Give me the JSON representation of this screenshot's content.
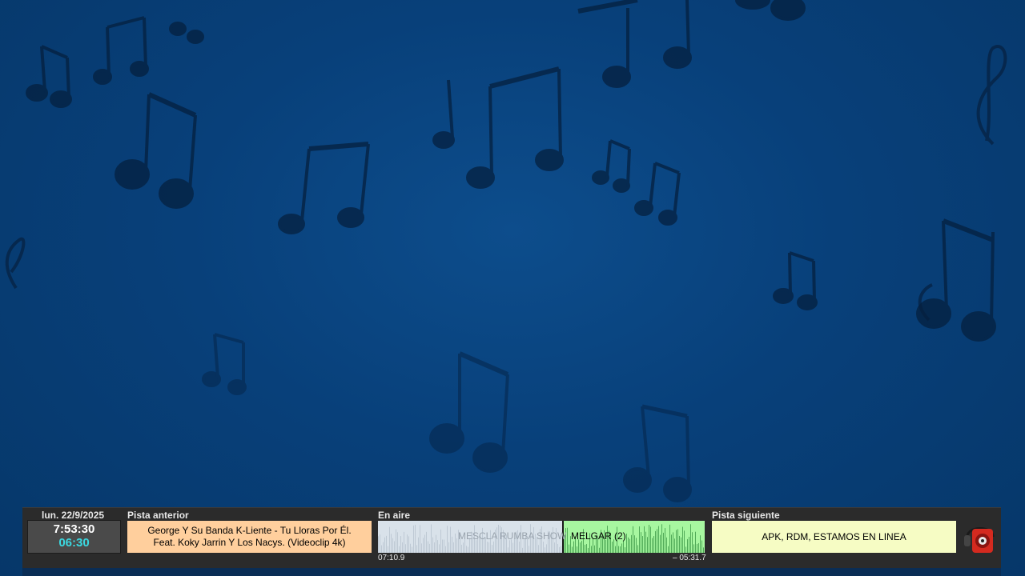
{
  "footer": {
    "date": "lun. 22/9/2025",
    "time": "7:53:30",
    "countdown": "06:30",
    "previous_label": "Pista anterior",
    "previous_track_line1": "George Y Su Banda K-Liente - Tu Lloras Por Él.",
    "previous_track_line2": "Feat. Koky Jarrin Y Los Nacys. (Videoclip 4k)",
    "onair_label": "En aire",
    "onair_segment_a": "MESCLA RUMBA SHOW",
    "onair_segment_b": "MELGAR (2)",
    "onair_progress": 0.565,
    "elapsed": "07:10.9",
    "remaining": "– 05:31.7",
    "next_label": "Pista siguiente",
    "next_track": "APK, RDM, ESTAMOS EN LINEA"
  },
  "icons": {
    "background": "music-notes-icon",
    "speaker": "speaker-icon"
  },
  "colors": {
    "background": "#08407a",
    "previous_bg": "#ffcf9d",
    "remaining_bg": "#a7f7a0",
    "next_bg": "#f6fcc4",
    "countdown": "#3bd8e0"
  }
}
